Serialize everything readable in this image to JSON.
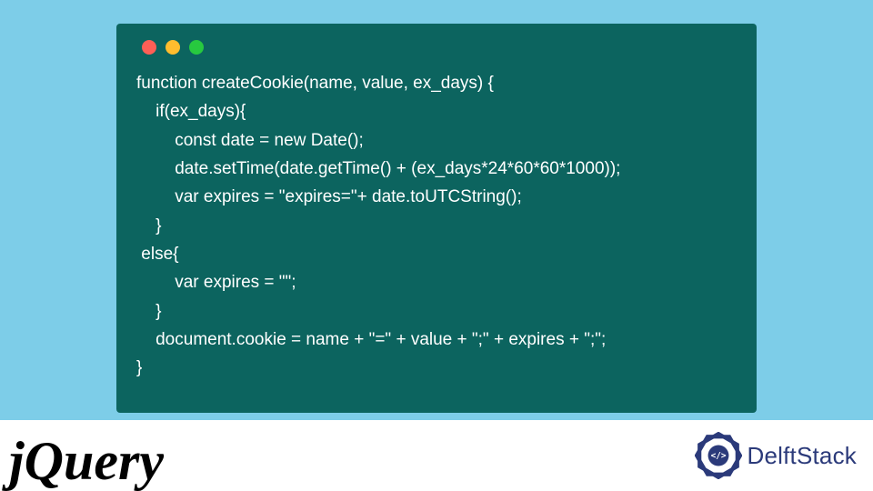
{
  "code": {
    "lines": [
      "function createCookie(name, value, ex_days) {",
      "    if(ex_days){",
      "        const date = new Date();",
      "        date.setTime(date.getTime() + (ex_days*24*60*60*1000));",
      "        var expires = \"expires=\"+ date.toUTCString();",
      "    }",
      " else{",
      "        var expires = \"\";",
      "    }",
      "    document.cookie = name + \"=\" + value + \";\" + expires + \";\";",
      "}"
    ]
  },
  "logos": {
    "jquery": "jQuery",
    "delftstack": "DelftStack"
  },
  "traffic_lights": [
    "red",
    "yellow",
    "green"
  ]
}
